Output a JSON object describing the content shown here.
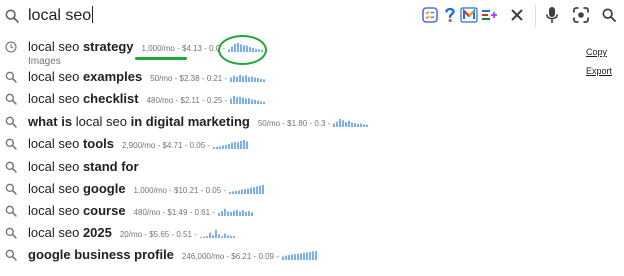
{
  "search": {
    "query": "local seo"
  },
  "actions": {
    "copy": "Copy",
    "export": "Export"
  },
  "colors": {
    "spark": "#7ab0f2",
    "annotation": "#22a63a",
    "muted": "#70757a"
  },
  "suggestions": [
    {
      "icon": "history-icon",
      "normal": "local seo",
      "bold": "strategy",
      "volume": "1,000/mo",
      "cpc": "$4.13",
      "competition": "0.0",
      "trend": [
        0.3,
        0.6,
        0.9,
        1,
        0.85,
        0.75,
        0.7,
        0.55,
        0.45,
        0.35,
        0.3,
        0.25
      ],
      "subtext": "Images"
    },
    {
      "icon": "search-icon",
      "normal": "local seo",
      "bold": "examples",
      "volume": "50/mo",
      "cpc": "$2.38",
      "competition": "0.21",
      "trend": [
        0.5,
        0.7,
        0.6,
        0.8,
        0.65,
        0.75,
        0.55,
        0.6,
        0.5,
        0.45,
        0.35,
        0.3
      ]
    },
    {
      "icon": "search-icon",
      "normal": "local seo",
      "bold": "checklist",
      "volume": "480/mo",
      "cpc": "$2.11",
      "competition": "0.25",
      "trend": [
        0.6,
        0.9,
        0.75,
        0.8,
        0.7,
        0.6,
        0.65,
        0.5,
        0.45,
        0.4,
        0.3,
        0.25
      ]
    },
    {
      "icon": "search-icon",
      "bold_prefix": "what is",
      "normal": "local seo",
      "bold": "in digital marketing",
      "volume": "50/mo",
      "cpc": "$1.80",
      "competition": "0.3",
      "trend": [
        0.4,
        0.6,
        0.9,
        0.75,
        0.55,
        0.7,
        0.5,
        0.45,
        0.35,
        0.4,
        0.3,
        0.25
      ]
    },
    {
      "icon": "search-icon",
      "normal": "local seo",
      "bold": "tools",
      "volume": "2,900/mo",
      "cpc": "$4.71",
      "competition": "0.05",
      "trend": [
        0.2,
        0.25,
        0.3,
        0.4,
        0.45,
        0.55,
        0.7,
        0.8,
        0.75,
        0.9,
        1,
        0.85
      ]
    },
    {
      "icon": "search-icon",
      "normal": "local seo",
      "bold": "stand for"
    },
    {
      "icon": "search-icon",
      "normal": "local seo",
      "bold": "google",
      "volume": "1,000/mo",
      "cpc": "$10.21",
      "competition": "0.05",
      "trend": [
        0.25,
        0.3,
        0.35,
        0.4,
        0.5,
        0.55,
        0.6,
        0.7,
        0.75,
        0.85,
        0.9,
        1
      ]
    },
    {
      "icon": "search-icon",
      "normal": "local seo",
      "bold": "course",
      "volume": "480/mo",
      "cpc": "$1.49",
      "competition": "0.61",
      "trend": [
        0.35,
        0.55,
        0.8,
        0.5,
        0.45,
        0.6,
        0.7,
        0.5,
        0.65,
        0.45,
        0.55,
        0.4
      ]
    },
    {
      "icon": "search-icon",
      "normal": "local seo",
      "bold": "2025",
      "volume": "20/mo",
      "cpc": "$5.65",
      "competition": "0.51",
      "trend": [
        0.1,
        0.15,
        0.2,
        0.6,
        0.3,
        0.9,
        0.4,
        0.2,
        0.5,
        0.3,
        0.25,
        0.2
      ]
    },
    {
      "icon": "search-icon",
      "normal": "",
      "bold": "google business profile",
      "volume": "246,000/mo",
      "cpc": "$6.21",
      "competition": "0.09",
      "trend": [
        0.4,
        0.5,
        0.55,
        0.6,
        0.65,
        0.7,
        0.75,
        0.8,
        0.85,
        0.9,
        0.95,
        1
      ]
    }
  ]
}
